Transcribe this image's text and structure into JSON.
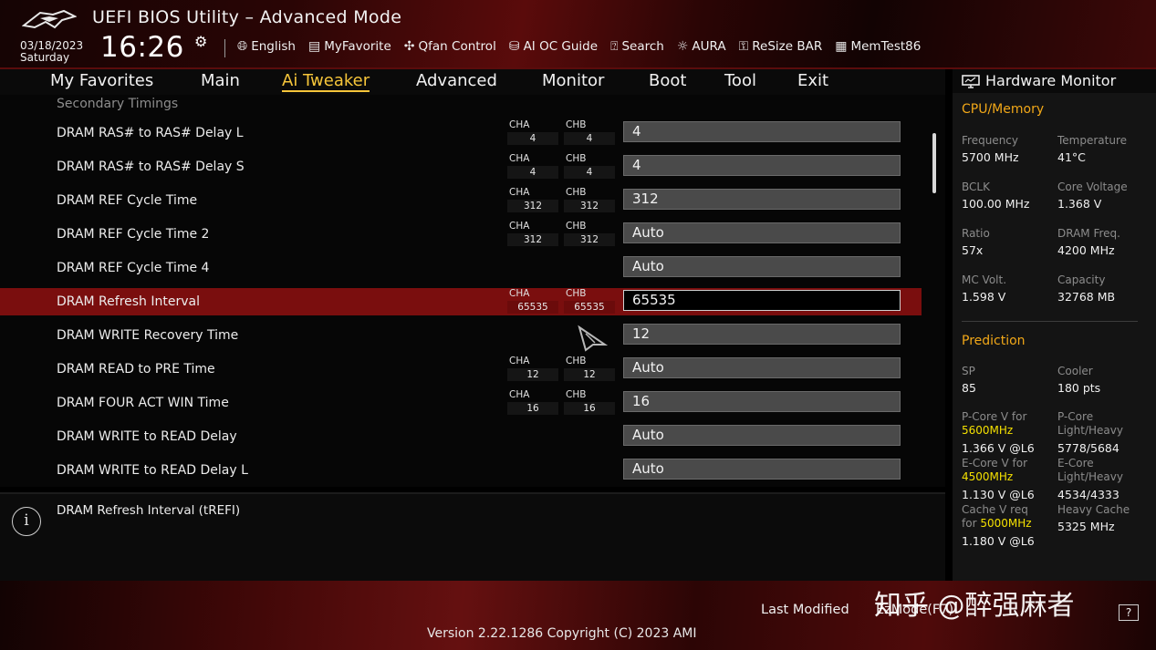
{
  "header": {
    "title": "UEFI BIOS Utility – Advanced Mode",
    "date": "03/18/2023",
    "day": "Saturday",
    "time": "16:26",
    "toolbar": [
      {
        "icon": "globe-icon",
        "label": "English"
      },
      {
        "icon": "favorite-icon",
        "label": "MyFavorite"
      },
      {
        "icon": "fan-icon",
        "label": "Qfan Control"
      },
      {
        "icon": "ai-oc-icon",
        "label": "AI OC Guide"
      },
      {
        "icon": "search-icon",
        "label": "Search"
      },
      {
        "icon": "aura-icon",
        "label": "AURA"
      },
      {
        "icon": "resize-bar-icon",
        "label": "ReSize BAR"
      },
      {
        "icon": "memtest-icon",
        "label": "MemTest86"
      }
    ]
  },
  "menu": {
    "tabs": [
      "My Favorites",
      "Main",
      "Ai Tweaker",
      "Advanced",
      "Monitor",
      "Boot",
      "Tool",
      "Exit"
    ],
    "active": "Ai Tweaker"
  },
  "main": {
    "section_title": "Secondary Timings",
    "rows": [
      {
        "label": "DRAM RAS# to RAS# Delay L",
        "cha": "4",
        "chb": "4",
        "value": "4"
      },
      {
        "label": "DRAM RAS# to RAS# Delay S",
        "cha": "4",
        "chb": "4",
        "value": "4"
      },
      {
        "label": "DRAM REF Cycle Time",
        "cha": "312",
        "chb": "312",
        "value": "312"
      },
      {
        "label": "DRAM REF Cycle Time 2",
        "cha": "312",
        "chb": "312",
        "value": "Auto"
      },
      {
        "label": "DRAM REF Cycle Time 4",
        "cha": "",
        "chb": "",
        "value": "Auto"
      },
      {
        "label": "DRAM Refresh Interval",
        "cha": "65535",
        "chb": "65535",
        "value": "65535",
        "selected": true
      },
      {
        "label": "DRAM WRITE Recovery Time",
        "cha": "",
        "chb": "",
        "value": "12"
      },
      {
        "label": "DRAM READ to PRE Time",
        "cha": "12",
        "chb": "12",
        "value": "Auto"
      },
      {
        "label": "DRAM FOUR ACT WIN Time",
        "cha": "16",
        "chb": "16",
        "value": "16"
      },
      {
        "label": "DRAM WRITE to READ Delay",
        "cha": "",
        "chb": "",
        "value": "Auto"
      },
      {
        "label": "DRAM WRITE to READ Delay L",
        "cha": "",
        "chb": "",
        "value": "Auto"
      }
    ],
    "channel_labels": {
      "a": "CHA",
      "b": "CHB"
    }
  },
  "help": {
    "text": "DRAM Refresh Interval (tREFI)"
  },
  "hwmon": {
    "title": "Hardware Monitor",
    "cpu_memory": {
      "title": "CPU/Memory",
      "items": [
        {
          "label": "Frequency",
          "value": "5700 MHz"
        },
        {
          "label": "Temperature",
          "value": "41°C"
        },
        {
          "label": "BCLK",
          "value": "100.00 MHz"
        },
        {
          "label": "Core Voltage",
          "value": "1.368 V"
        },
        {
          "label": "Ratio",
          "value": "57x"
        },
        {
          "label": "DRAM Freq.",
          "value": "4200 MHz"
        },
        {
          "label": "MC Volt.",
          "value": "1.598 V"
        },
        {
          "label": "Capacity",
          "value": "32768 MB"
        }
      ]
    },
    "prediction": {
      "title": "Prediction",
      "sp_label": "SP",
      "sp_value": "85",
      "cooler_label": "Cooler",
      "cooler_value": "180 pts",
      "pcore_v_label": "P-Core V for",
      "pcore_v_freq": "5600MHz",
      "pcore_v_value": "1.366 V @L6",
      "pcore_lh_label1": "P-Core",
      "pcore_lh_label2": "Light/Heavy",
      "pcore_lh_value": "5778/5684",
      "ecore_v_label": "E-Core V for",
      "ecore_v_freq": "4500MHz",
      "ecore_v_value": "1.130 V @L6",
      "ecore_lh_label1": "E-Core",
      "ecore_lh_label2": "Light/Heavy",
      "ecore_lh_value": "4534/4333",
      "cache_v_label1": "Cache V req",
      "cache_v_label2_prefix": "for",
      "cache_v_freq": "5000MHz",
      "cache_v_value": "1.180 V @L6",
      "heavy_cache_label": "Heavy Cache",
      "heavy_cache_value": "5325 MHz"
    }
  },
  "footer": {
    "last_modified": "Last Modified",
    "ez_mode": "EzMode(F7)",
    "help_key": "?",
    "version": "Version 2.22.1286 Copyright (C) 2023 AMI",
    "watermark": "知乎 @醉强麻者"
  },
  "colors": {
    "accent_yellow": "#f6c53a",
    "section_orange": "#f2a818",
    "selected_row": "#7a0e0e",
    "highlight_freq": "#f4e000"
  }
}
